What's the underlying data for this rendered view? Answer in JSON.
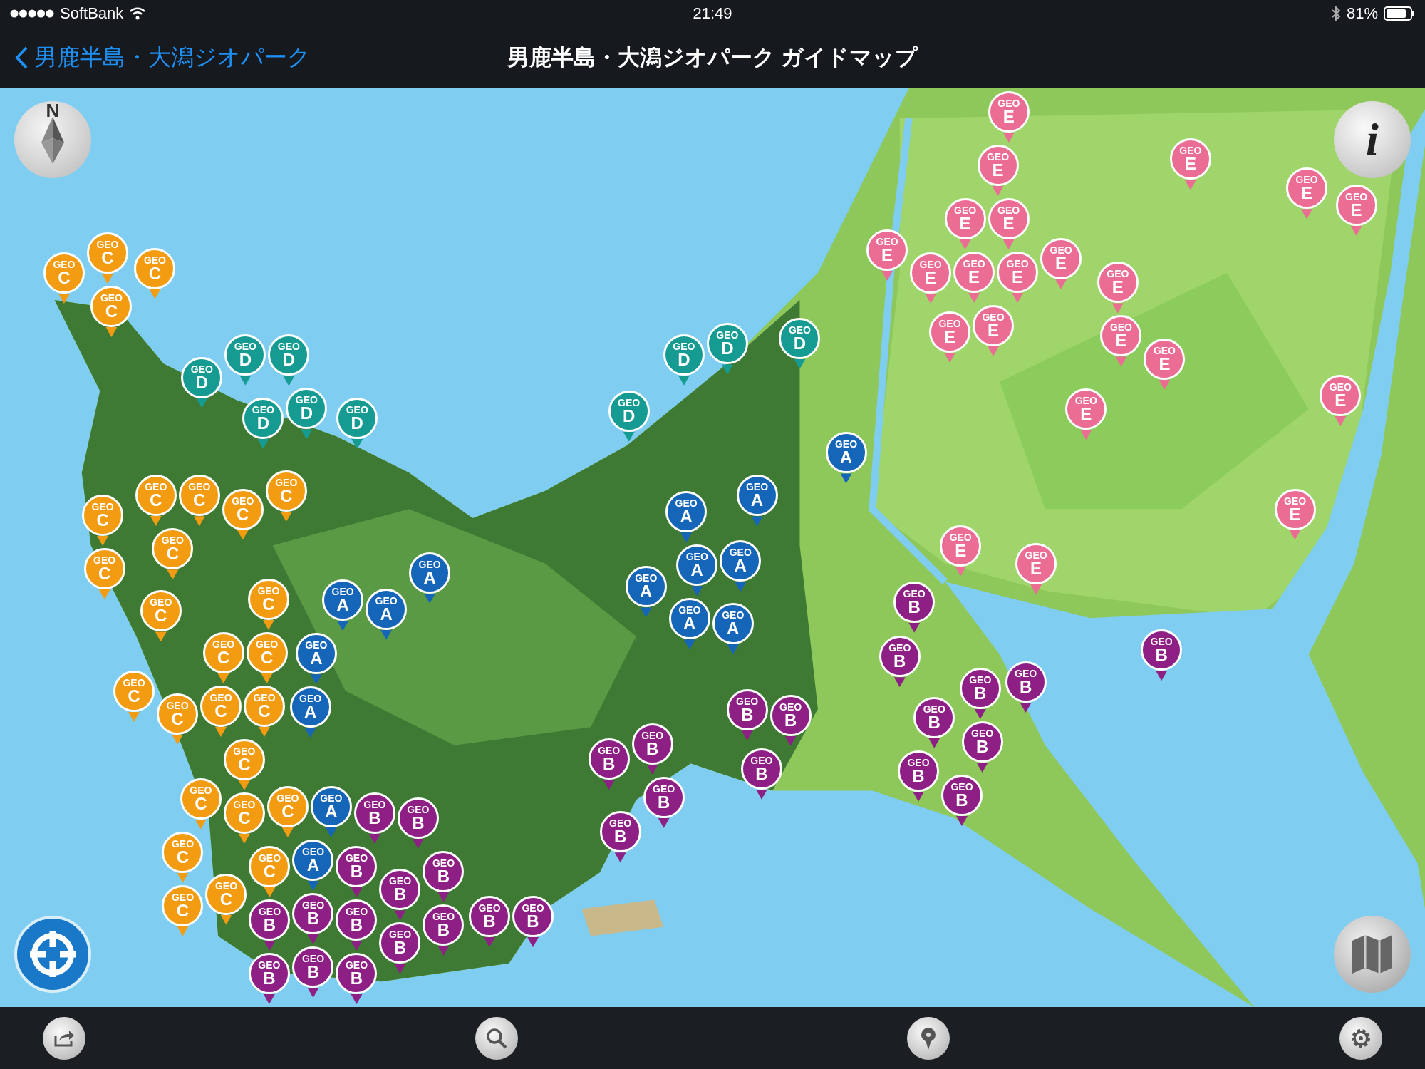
{
  "status_bar": {
    "carrier": "SoftBank",
    "time": "21:49",
    "battery": "81%"
  },
  "nav_bar": {
    "back_label": "男鹿半島・大潟ジオパーク",
    "title": "男鹿半島・大潟ジオパーク ガイドマップ"
  },
  "map": {
    "kind": "picture",
    "compass": {
      "label": "N"
    },
    "info_button": {
      "label": "i"
    },
    "pins": [
      {
        "label": "GEO",
        "letter": "C",
        "color": "#f39c12"
      },
      {
        "label": "GEO",
        "letter": "C",
        "color": "#f39c12"
      },
      {
        "label": "GEO",
        "letter": "C",
        "color": "#f39c12"
      },
      {
        "label": "GEO",
        "letter": "C",
        "color": "#f39c12"
      },
      {
        "label": "GEO",
        "letter": "C",
        "color": "#f39c12"
      },
      {
        "label": "GEO",
        "letter": "C",
        "color": "#f39c12"
      },
      {
        "label": "GEO",
        "letter": "C",
        "color": "#f39c12"
      },
      {
        "label": "GEO",
        "letter": "C",
        "color": "#f39c12"
      },
      {
        "label": "GEO",
        "letter": "C",
        "color": "#f39c12"
      },
      {
        "label": "GEO",
        "letter": "C",
        "color": "#f39c12"
      },
      {
        "label": "GEO",
        "letter": "C",
        "color": "#f39c12"
      },
      {
        "label": "GEO",
        "letter": "C",
        "color": "#f39c12"
      },
      {
        "label": "GEO",
        "letter": "C",
        "color": "#f39c12"
      },
      {
        "label": "GEO",
        "letter": "C",
        "color": "#f39c12"
      },
      {
        "label": "GEO",
        "letter": "C",
        "color": "#f39c12"
      },
      {
        "label": "GEO",
        "letter": "C",
        "color": "#f39c12"
      },
      {
        "label": "GEO",
        "letter": "C",
        "color": "#f39c12"
      },
      {
        "label": "GEO",
        "letter": "C",
        "color": "#f39c12"
      },
      {
        "label": "GEO",
        "letter": "C",
        "color": "#f39c12"
      },
      {
        "label": "GEO",
        "letter": "C",
        "color": "#f39c12"
      },
      {
        "label": "GEO",
        "letter": "C",
        "color": "#f39c12"
      },
      {
        "label": "GEO",
        "letter": "C",
        "color": "#f39c12"
      },
      {
        "label": "GEO",
        "letter": "C",
        "color": "#f39c12"
      },
      {
        "label": "GEO",
        "letter": "C",
        "color": "#f39c12"
      },
      {
        "label": "GEO",
        "letter": "C",
        "color": "#f39c12"
      },
      {
        "label": "GEO",
        "letter": "C",
        "color": "#f39c12"
      },
      {
        "label": "GEO",
        "letter": "C",
        "color": "#f39c12"
      },
      {
        "label": "GEO",
        "letter": "D",
        "color": "#169b93"
      },
      {
        "label": "GEO",
        "letter": "D",
        "color": "#169b93"
      },
      {
        "label": "GEO",
        "letter": "D",
        "color": "#169b93"
      },
      {
        "label": "GEO",
        "letter": "D",
        "color": "#169b93"
      },
      {
        "label": "GEO",
        "letter": "D",
        "color": "#169b93"
      },
      {
        "label": "GEO",
        "letter": "D",
        "color": "#169b93"
      },
      {
        "label": "GEO",
        "letter": "D",
        "color": "#169b93"
      },
      {
        "label": "GEO",
        "letter": "D",
        "color": "#169b93"
      },
      {
        "label": "GEO",
        "letter": "D",
        "color": "#169b93"
      },
      {
        "label": "GEO",
        "letter": "D",
        "color": "#169b93"
      },
      {
        "label": "GEO",
        "letter": "A",
        "color": "#1565b8"
      },
      {
        "label": "GEO",
        "letter": "A",
        "color": "#1565b8"
      },
      {
        "label": "GEO",
        "letter": "A",
        "color": "#1565b8"
      },
      {
        "label": "GEO",
        "letter": "A",
        "color": "#1565b8"
      },
      {
        "label": "GEO",
        "letter": "A",
        "color": "#1565b8"
      },
      {
        "label": "GEO",
        "letter": "A",
        "color": "#1565b8"
      },
      {
        "label": "GEO",
        "letter": "A",
        "color": "#1565b8"
      },
      {
        "label": "GEO",
        "letter": "A",
        "color": "#1565b8"
      },
      {
        "label": "GEO",
        "letter": "A",
        "color": "#1565b8"
      },
      {
        "label": "GEO",
        "letter": "A",
        "color": "#1565b8"
      },
      {
        "label": "GEO",
        "letter": "A",
        "color": "#1565b8"
      },
      {
        "label": "GEO",
        "letter": "A",
        "color": "#1565b8"
      },
      {
        "label": "GEO",
        "letter": "A",
        "color": "#1565b8"
      },
      {
        "label": "GEO",
        "letter": "A",
        "color": "#1565b8"
      },
      {
        "label": "GEO",
        "letter": "A",
        "color": "#1565b8"
      },
      {
        "label": "GEO",
        "letter": "B",
        "color": "#8e1f84"
      },
      {
        "label": "GEO",
        "letter": "B",
        "color": "#8e1f84"
      },
      {
        "label": "GEO",
        "letter": "B",
        "color": "#8e1f84"
      },
      {
        "label": "GEO",
        "letter": "B",
        "color": "#8e1f84"
      },
      {
        "label": "GEO",
        "letter": "B",
        "color": "#8e1f84"
      },
      {
        "label": "GEO",
        "letter": "B",
        "color": "#8e1f84"
      },
      {
        "label": "GEO",
        "letter": "B",
        "color": "#8e1f84"
      },
      {
        "label": "GEO",
        "letter": "B",
        "color": "#8e1f84"
      },
      {
        "label": "GEO",
        "letter": "B",
        "color": "#8e1f84"
      },
      {
        "label": "GEO",
        "letter": "B",
        "color": "#8e1f84"
      },
      {
        "label": "GEO",
        "letter": "B",
        "color": "#8e1f84"
      },
      {
        "label": "GEO",
        "letter": "B",
        "color": "#8e1f84"
      },
      {
        "label": "GEO",
        "letter": "B",
        "color": "#8e1f84"
      },
      {
        "label": "GEO",
        "letter": "B",
        "color": "#8e1f84"
      },
      {
        "label": "GEO",
        "letter": "B",
        "color": "#8e1f84"
      },
      {
        "label": "GEO",
        "letter": "B",
        "color": "#8e1f84"
      },
      {
        "label": "GEO",
        "letter": "B",
        "color": "#8e1f84"
      },
      {
        "label": "GEO",
        "letter": "B",
        "color": "#8e1f84"
      },
      {
        "label": "GEO",
        "letter": "B",
        "color": "#8e1f84"
      },
      {
        "label": "GEO",
        "letter": "B",
        "color": "#8e1f84"
      },
      {
        "label": "GEO",
        "letter": "B",
        "color": "#8e1f84"
      },
      {
        "label": "GEO",
        "letter": "B",
        "color": "#8e1f84"
      },
      {
        "label": "GEO",
        "letter": "B",
        "color": "#8e1f84"
      },
      {
        "label": "GEO",
        "letter": "B",
        "color": "#8e1f84"
      },
      {
        "label": "GEO",
        "letter": "B",
        "color": "#8e1f84"
      },
      {
        "label": "GEO",
        "letter": "B",
        "color": "#8e1f84"
      },
      {
        "label": "GEO",
        "letter": "B",
        "color": "#8e1f84"
      },
      {
        "label": "GEO",
        "letter": "B",
        "color": "#8e1f84"
      },
      {
        "label": "GEO",
        "letter": "B",
        "color": "#8e1f84"
      },
      {
        "label": "GEO",
        "letter": "B",
        "color": "#8e1f84"
      },
      {
        "label": "GEO",
        "letter": "B",
        "color": "#8e1f84"
      },
      {
        "label": "GEO",
        "letter": "E",
        "color": "#ec6d94"
      },
      {
        "label": "GEO",
        "letter": "E",
        "color": "#ec6d94"
      },
      {
        "label": "GEO",
        "letter": "E",
        "color": "#ec6d94"
      },
      {
        "label": "GEO",
        "letter": "E",
        "color": "#ec6d94"
      },
      {
        "label": "GEO",
        "letter": "E",
        "color": "#ec6d94"
      },
      {
        "label": "GEO",
        "letter": "E",
        "color": "#ec6d94"
      },
      {
        "label": "GEO",
        "letter": "E",
        "color": "#ec6d94"
      },
      {
        "label": "GEO",
        "letter": "E",
        "color": "#ec6d94"
      },
      {
        "label": "GEO",
        "letter": "E",
        "color": "#ec6d94"
      },
      {
        "label": "GEO",
        "letter": "E",
        "color": "#ec6d94"
      },
      {
        "label": "GEO",
        "letter": "E",
        "color": "#ec6d94"
      },
      {
        "label": "GEO",
        "letter": "E",
        "color": "#ec6d94"
      },
      {
        "label": "GEO",
        "letter": "E",
        "color": "#ec6d94"
      },
      {
        "label": "GEO",
        "letter": "E",
        "color": "#ec6d94"
      },
      {
        "label": "GEO",
        "letter": "E",
        "color": "#ec6d94"
      },
      {
        "label": "GEO",
        "letter": "E",
        "color": "#ec6d94"
      },
      {
        "label": "GEO",
        "letter": "E",
        "color": "#ec6d94"
      },
      {
        "label": "GEO",
        "letter": "E",
        "color": "#ec6d94"
      },
      {
        "label": "GEO",
        "letter": "E",
        "color": "#ec6d94"
      },
      {
        "label": "GEO",
        "letter": "E",
        "color": "#ec6d94"
      },
      {
        "label": "GEO",
        "letter": "E",
        "color": "#ec6d94"
      },
      {
        "label": "GEO",
        "letter": "E",
        "color": "#ec6d94"
      }
    ]
  }
}
